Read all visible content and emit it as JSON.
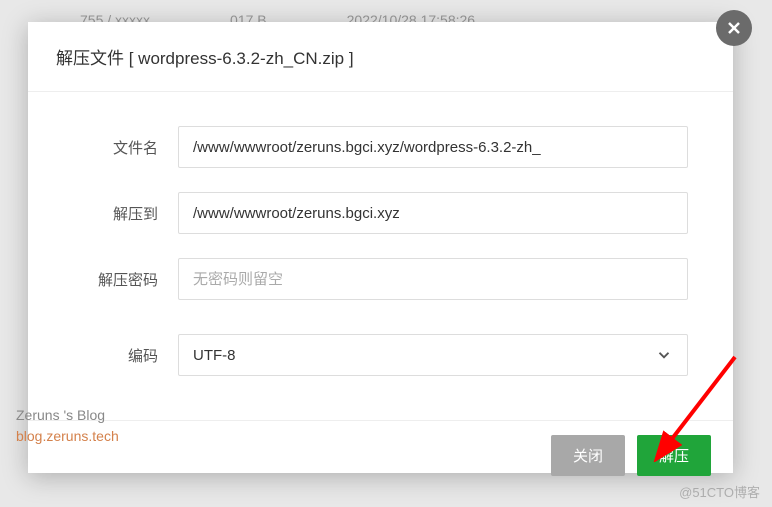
{
  "backdrop": {
    "col1": "755 / xxxxx",
    "col2": "017 B",
    "col3": "2022/10/28 17:58:26"
  },
  "modal": {
    "title": "解压文件 [ wordpress-6.3.2-zh_CN.zip ]",
    "fields": {
      "filename": {
        "label": "文件名",
        "value": "/www/wwwroot/zeruns.bgci.xyz/wordpress-6.3.2-zh_"
      },
      "extractTo": {
        "label": "解压到",
        "value": "/www/wwwroot/zeruns.bgci.xyz"
      },
      "password": {
        "label": "解压密码",
        "value": "",
        "placeholder": "无密码则留空"
      },
      "encoding": {
        "label": "编码",
        "value": "UTF-8"
      }
    },
    "buttons": {
      "cancel": "关闭",
      "confirm": "解压"
    }
  },
  "watermark": {
    "blog1": "Zeruns 's Blog",
    "blog2": "blog.zeruns.tech",
    "site": "@51CTO博客"
  }
}
